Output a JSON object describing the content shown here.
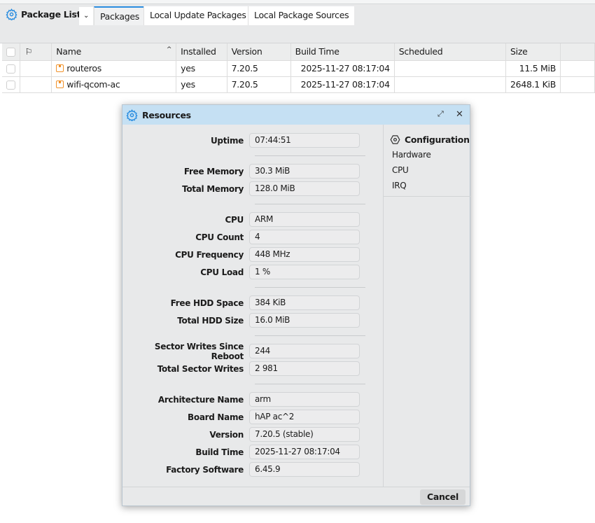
{
  "window": {
    "title": "Package List",
    "tabs": [
      "Packages",
      "Local Update Packages",
      "Local Package Sources"
    ],
    "dropdown_icon": "chevron-down-icon"
  },
  "table": {
    "columns": [
      "Name",
      "Installed",
      "Version",
      "Build Time",
      "Scheduled",
      "Size"
    ],
    "rows": [
      {
        "name": "routeros",
        "installed": "yes",
        "version": "7.20.5",
        "build_time": "2025-11-27 08:17:04",
        "scheduled": "",
        "size": "11.5 MiB"
      },
      {
        "name": "wifi-qcom-ac",
        "installed": "yes",
        "version": "7.20.5",
        "build_time": "2025-11-27 08:17:04",
        "scheduled": "",
        "size": "2648.1 KiB"
      }
    ]
  },
  "dialog": {
    "title": "Resources",
    "groups": [
      [
        {
          "label": "Uptime",
          "value": "07:44:51"
        }
      ],
      [
        {
          "label": "Free Memory",
          "value": "30.3 MiB"
        },
        {
          "label": "Total Memory",
          "value": "128.0 MiB"
        }
      ],
      [
        {
          "label": "CPU",
          "value": "ARM"
        },
        {
          "label": "CPU Count",
          "value": "4"
        },
        {
          "label": "CPU Frequency",
          "value": "448 MHz"
        },
        {
          "label": "CPU Load",
          "value": "1 %"
        }
      ],
      [
        {
          "label": "Free HDD Space",
          "value": "384 KiB"
        },
        {
          "label": "Total HDD Size",
          "value": "16.0 MiB"
        }
      ],
      [
        {
          "label": "Sector Writes Since Reboot",
          "value": "244"
        },
        {
          "label": "Total Sector Writes",
          "value": "2 981"
        }
      ],
      [
        {
          "label": "Architecture Name",
          "value": "arm"
        },
        {
          "label": "Board Name",
          "value": "hAP ac^2"
        },
        {
          "label": "Version",
          "value": "7.20.5 (stable)"
        },
        {
          "label": "Build Time",
          "value": "2025-11-27 08:17:04"
        },
        {
          "label": "Factory Software",
          "value": "6.45.9"
        }
      ]
    ],
    "side": {
      "heading": "Configuration",
      "items": [
        "Hardware",
        "CPU",
        "IRQ"
      ]
    },
    "cancel": "Cancel"
  }
}
